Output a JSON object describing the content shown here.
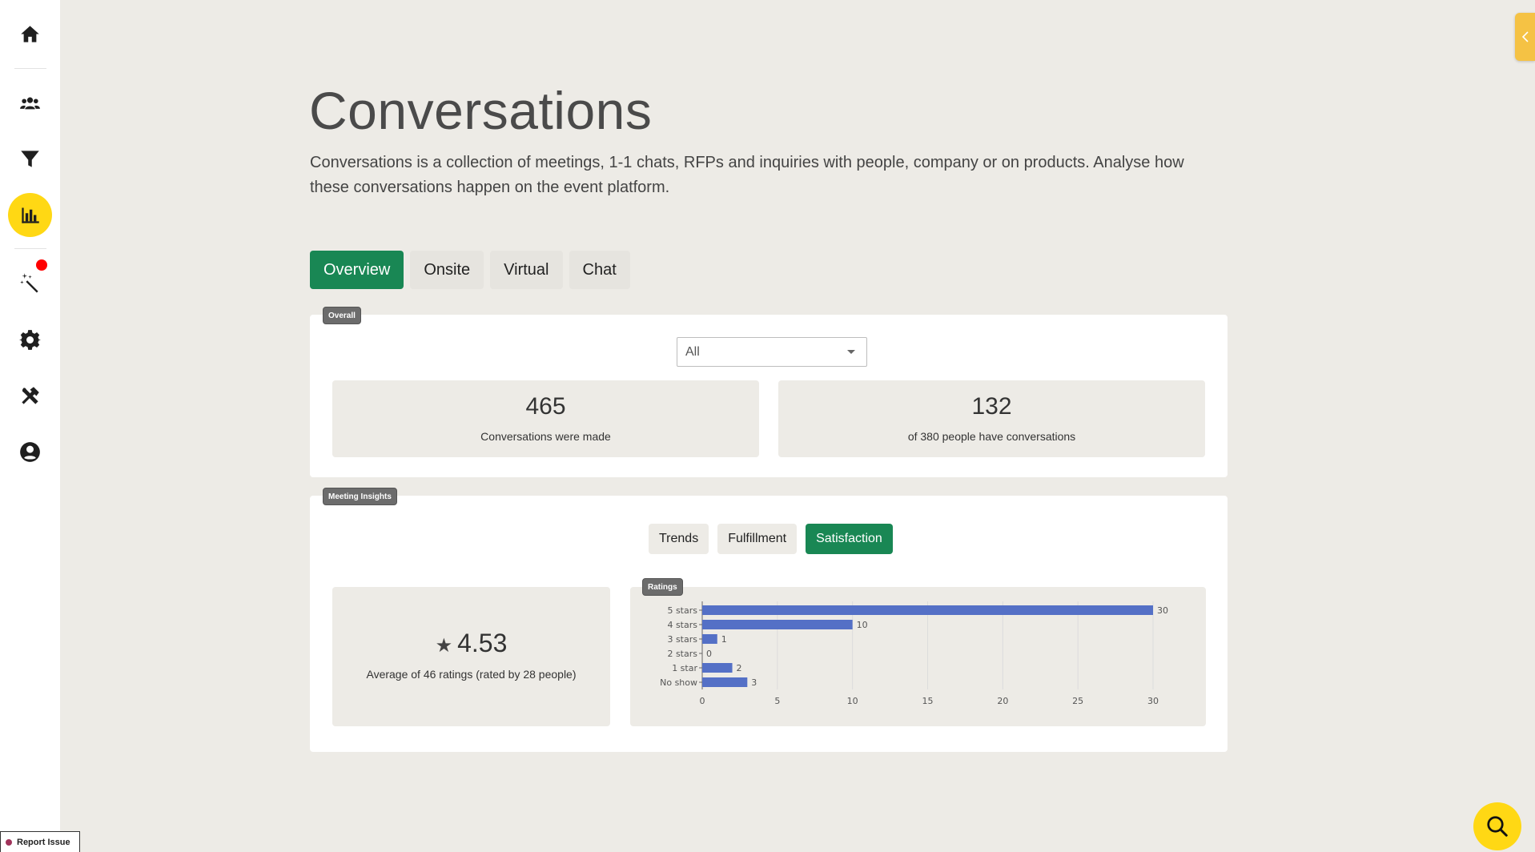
{
  "page": {
    "title": "Conversations",
    "description": "Conversations is a collection of meetings, 1-1 chats, RFPs and inquiries with people, company or on products. Analyse how these conversations happen on the event platform."
  },
  "sidebar": {
    "items": [
      {
        "icon": "home-icon"
      },
      {
        "icon": "people-icon"
      },
      {
        "icon": "filter-icon"
      },
      {
        "icon": "bar-chart-icon",
        "active": true
      },
      {
        "icon": "magic-wand-icon",
        "notification": true
      },
      {
        "icon": "gear-icon"
      },
      {
        "icon": "tools-icon"
      },
      {
        "icon": "user-circle-icon"
      }
    ],
    "report_issue": "Report Issue"
  },
  "tabs": [
    {
      "label": "Overview",
      "active": true
    },
    {
      "label": "Onsite"
    },
    {
      "label": "Virtual"
    },
    {
      "label": "Chat"
    }
  ],
  "overall": {
    "tag": "Overall",
    "select_value": "All",
    "stats": [
      {
        "value": "465",
        "label": "Conversations were made"
      },
      {
        "value": "132",
        "label": "of 380 people have conversations"
      }
    ]
  },
  "insights": {
    "tag": "Meeting Insights",
    "subtabs": [
      {
        "label": "Trends"
      },
      {
        "label": "Fulfillment"
      },
      {
        "label": "Satisfaction",
        "active": true
      }
    ],
    "rating": {
      "star": "★",
      "value": "4.53",
      "label": "Average of 46 ratings (rated by 28 people)"
    },
    "chart_tag": "Ratings"
  },
  "chart_data": {
    "type": "bar",
    "orientation": "horizontal",
    "categories": [
      "5 stars",
      "4 stars",
      "3 stars",
      "2 stars",
      "1 star",
      "No show"
    ],
    "values": [
      30,
      10,
      1,
      0,
      2,
      3
    ],
    "xlim": [
      0,
      30
    ],
    "xticks": [
      0,
      5,
      10,
      15,
      20,
      25,
      30
    ],
    "grid": true,
    "bar_color": "#5470c6",
    "data_labels": true
  },
  "colors": {
    "accent_green": "#198754",
    "brand_yellow": "#ffd814",
    "background": "#edebe6"
  }
}
